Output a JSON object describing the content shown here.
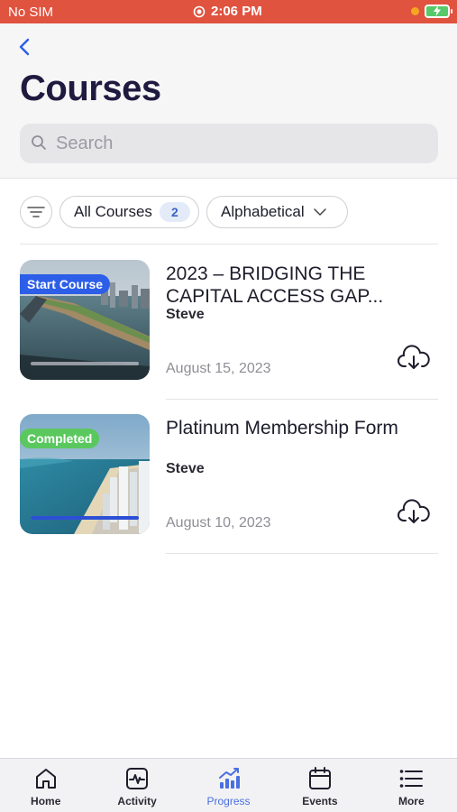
{
  "status_bar": {
    "carrier": "No SIM",
    "time": "2:06 PM"
  },
  "header": {
    "title": "Courses",
    "search_placeholder": "Search"
  },
  "filters": {
    "all_courses_label": "All Courses",
    "course_count": "2",
    "sort_label": "Alphabetical"
  },
  "courses": [
    {
      "badge": "Start Course",
      "title": "2023 – BRIDGING THE CAPITAL ACCESS GAP...",
      "author": "Steve",
      "date": "August 15, 2023",
      "progress": 0
    },
    {
      "badge": "Completed",
      "title": "Platinum Membership Form",
      "author": "Steve",
      "date": "August 10, 2023",
      "progress": 1
    }
  ],
  "tabs": [
    {
      "label": "Home",
      "icon": "home-icon"
    },
    {
      "label": "Activity",
      "icon": "activity-icon"
    },
    {
      "label": "Progress",
      "icon": "progress-icon"
    },
    {
      "label": "Events",
      "icon": "calendar-icon"
    },
    {
      "label": "More",
      "icon": "menu-icon"
    }
  ],
  "colors": {
    "status_bar": "#e0533f",
    "accent": "#2c5ee8",
    "completed": "#5ac85e",
    "title": "#1f1a3f"
  }
}
